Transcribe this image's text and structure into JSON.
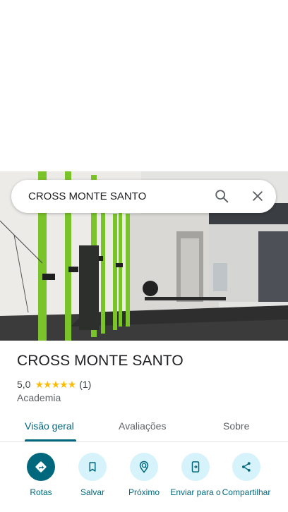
{
  "search": {
    "query": "CROSS MONTE SANTO"
  },
  "place": {
    "name": "CROSS MONTE SANTO",
    "rating": "5,0",
    "stars": "★★★★★",
    "review_count": "(1)",
    "category": "Academia"
  },
  "tabs": [
    {
      "label": "Visão geral",
      "active": true
    },
    {
      "label": "Avaliações",
      "active": false
    },
    {
      "label": "Sobre",
      "active": false
    }
  ],
  "actions": [
    {
      "label": "Rotas",
      "icon": "directions-icon"
    },
    {
      "label": "Salvar",
      "icon": "bookmark-icon"
    },
    {
      "label": "Próximo",
      "icon": "nearby-icon"
    },
    {
      "label": "Enviar para o",
      "icon": "send-to-phone-icon"
    },
    {
      "label": "Compartilhar",
      "icon": "share-icon"
    }
  ],
  "colors": {
    "accent": "#00677d",
    "accent_light": "#d6f2fb",
    "stars": "#fbbc04"
  }
}
